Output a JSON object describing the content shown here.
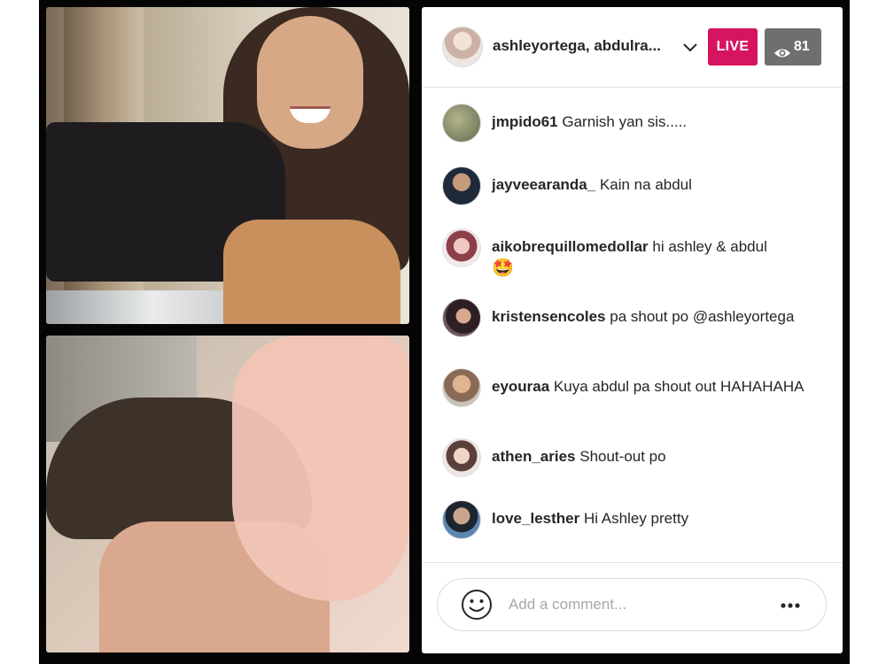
{
  "header": {
    "host_name": "ashleyortega, abdulra...",
    "live_label": "LIVE",
    "viewer_count": "81",
    "chevron_icon": "chevron-down-icon",
    "viewer_icon": "eye-icon"
  },
  "comments": [
    {
      "username": "jmpido61",
      "text": "Garnish yan sis.....",
      "avatar_color": "#8a8f6a"
    },
    {
      "username": "jayveearanda_",
      "text": "Kain na abdul",
      "avatar_color": "#3a3f4a"
    },
    {
      "username": "aikobrequillomedollar",
      "text": "hi ashley & abdul",
      "emoji": "🤩",
      "avatar_color": "#c9a3a8"
    },
    {
      "username": "kristensencoles",
      "text": "pa shout po @ashleyortega",
      "avatar_color": "#6b4e56"
    },
    {
      "username": "eyouraa",
      "text": "Kuya abdul pa shout out HAHAHAHA",
      "avatar_color": "#a58f80"
    },
    {
      "username": "athen_aries",
      "text": "Shout-out po",
      "avatar_color": "#b89a91"
    },
    {
      "username": "love_lesther",
      "text": "Hi Ashley pretty",
      "avatar_color": "#4d6a88"
    }
  ],
  "composer": {
    "placeholder": "Add a comment...",
    "emoji_icon": "smiley-icon",
    "more_icon": "more-options-icon"
  },
  "colors": {
    "live_badge": "#d6145f",
    "viewer_badge": "#6f6f6f",
    "frame": "#050505"
  }
}
